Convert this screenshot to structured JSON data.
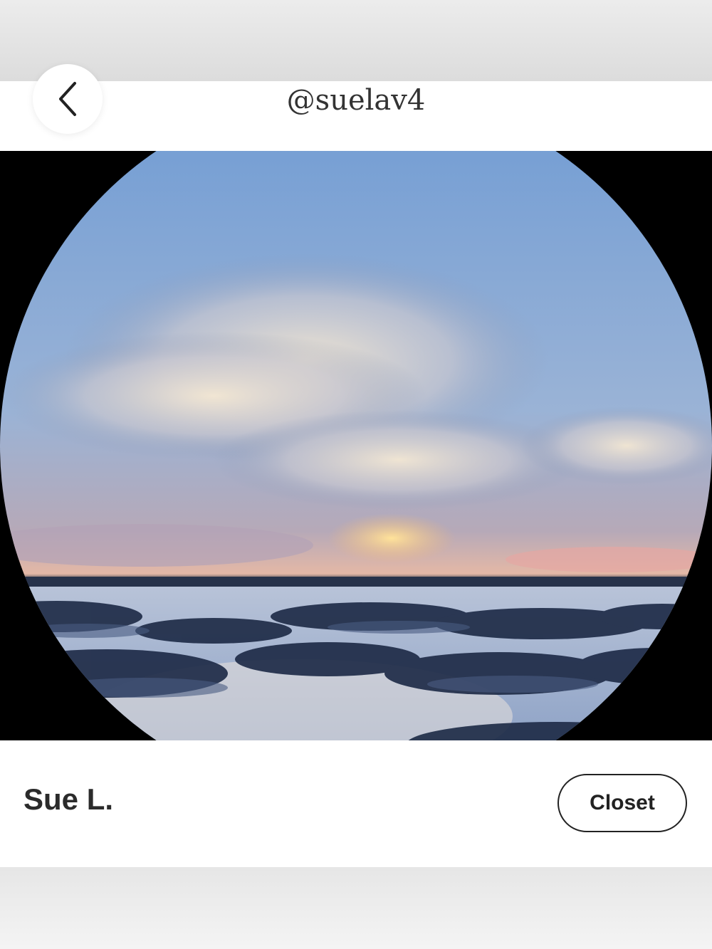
{
  "header": {
    "back_icon": "chevron-left-icon",
    "handle": "@suelav4"
  },
  "profile": {
    "photo": "beach-sunset-photo",
    "name": "Sue L.",
    "closet_label": "Closet"
  },
  "colors": {
    "sheet_background": "#ffffff",
    "photo_frame": "#000000",
    "text_primary": "#2b2b2b",
    "button_border": "#222222",
    "backdrop": "#e4e4e4"
  }
}
